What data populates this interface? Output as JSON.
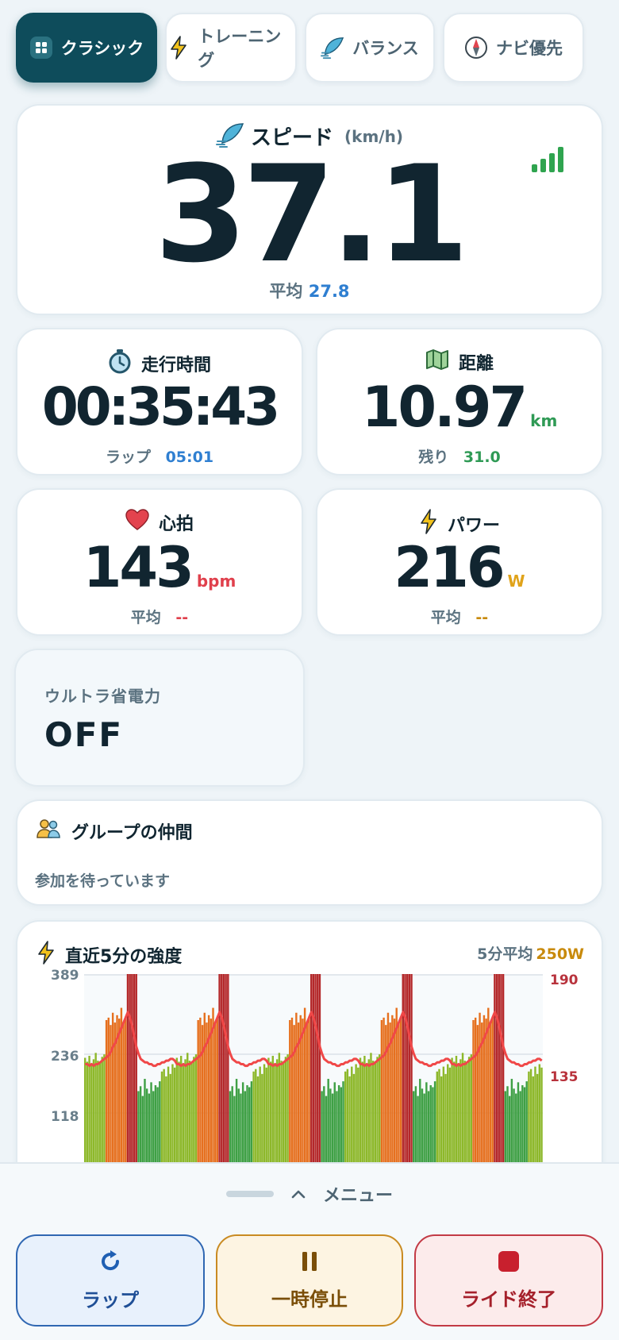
{
  "tabs": [
    {
      "label": "クラシック",
      "icon": "grid-icon",
      "active": true
    },
    {
      "label": "トレーニング",
      "icon": "lightning-icon",
      "active": false
    },
    {
      "label": "バランス",
      "icon": "feather-icon",
      "active": false
    },
    {
      "label": "ナビ優先",
      "icon": "compass-icon",
      "active": false
    }
  ],
  "speed": {
    "title": "スピード",
    "unit": "(km/h)",
    "value": "37.1",
    "avg_label": "平均",
    "avg_value": "27.8",
    "signal_icon": "signal-bars-icon"
  },
  "ride_time": {
    "title": "走行時間",
    "value": "00:35:43",
    "sub_label": "ラップ",
    "sub_value": "05:01"
  },
  "distance": {
    "title": "距離",
    "value": "10.97",
    "unit": "km",
    "sub_label": "残り",
    "sub_value": "31.0"
  },
  "heart_rate": {
    "title": "心拍",
    "value": "143",
    "unit": "bpm",
    "sub_label": "平均",
    "sub_value": "--"
  },
  "power": {
    "title": "パワー",
    "value": "216",
    "unit": "W",
    "sub_label": "平均",
    "sub_value": "--"
  },
  "ultra_saver": {
    "label": "ウルトラ省電力",
    "value": "OFF"
  },
  "group": {
    "title": "グループの仲間",
    "status": "参加を待っています"
  },
  "intensity": {
    "title": "直近5分の強度",
    "avg_label": "5分平均",
    "avg_value": "250W"
  },
  "chart_data": {
    "type": "bar",
    "title": "直近5分の強度",
    "y_left_ticks": [
      "389",
      "236",
      "118"
    ],
    "y_right_ticks": [
      "190",
      "135"
    ],
    "ylim": [
      0,
      389
    ],
    "hr_ylim": [
      80,
      190
    ],
    "power_pattern": [
      218,
      210,
      222,
      205,
      215,
      228,
      212,
      208,
      220,
      225,
      295,
      300,
      285,
      310,
      290,
      305,
      298,
      320,
      288,
      302,
      389,
      389,
      389,
      389,
      389,
      150,
      160,
      140,
      175,
      155,
      145,
      168,
      150,
      162,
      158,
      170,
      190,
      195,
      180,
      200,
      185,
      205,
      198
    ],
    "hr_pattern": [
      138,
      138,
      137,
      138,
      137,
      138,
      138,
      139,
      140,
      141,
      142,
      143,
      145,
      148,
      150,
      153,
      156,
      159,
      162,
      165,
      168,
      165,
      160,
      154,
      148,
      144,
      141,
      140,
      139,
      139,
      138,
      138,
      137,
      137,
      138,
      138,
      139,
      139,
      140,
      140,
      141,
      141,
      140
    ],
    "cycles": 5,
    "colors": {
      "green": "#3fa045",
      "lightgreen": "#8db82a",
      "orange": "#e6701f",
      "darkred": "#b4282a",
      "hr_line": "#f04848"
    }
  },
  "sheet": {
    "menu_label": "メニュー"
  },
  "buttons": {
    "lap": "ラップ",
    "pause": "一時停止",
    "end": "ライド終了"
  }
}
